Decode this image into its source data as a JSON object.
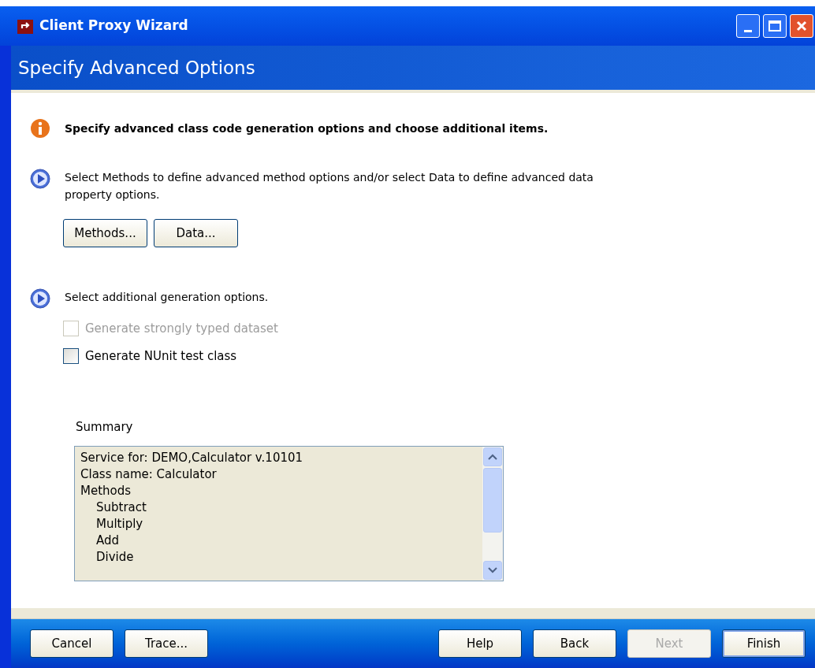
{
  "window": {
    "title": "Client Proxy Wizard"
  },
  "header": {
    "title": "Specify Advanced Options"
  },
  "intro": "Specify advanced class code generation options and choose additional items.",
  "steps": [
    {
      "text": "Select Methods to define advanced method options and/or select Data to define advanced data property options.",
      "buttons": [
        {
          "label": "Methods..."
        },
        {
          "label": "Data..."
        }
      ]
    },
    {
      "text": "Select additional generation options.",
      "options": [
        {
          "label": "Generate strongly typed dataset",
          "checked": false,
          "disabled": true
        },
        {
          "label": "Generate NUnit test class",
          "checked": false,
          "disabled": false
        }
      ]
    }
  ],
  "summary": {
    "label": "Summary",
    "lines": [
      {
        "text": "Service for: DEMO,Calculator v.10101"
      },
      {
        "text": "Class name: Calculator"
      },
      {
        "text": "Methods",
        "children": [
          {
            "text": "Subtract"
          },
          {
            "text": "Multiply"
          },
          {
            "text": "Add"
          },
          {
            "text": "Divide"
          }
        ]
      }
    ]
  },
  "footer": {
    "left": [
      {
        "label": "Cancel",
        "disabled": false,
        "default": false
      },
      {
        "label": "Trace...",
        "disabled": false,
        "default": false
      }
    ],
    "right": [
      {
        "label": "Help",
        "disabled": false,
        "default": false
      },
      {
        "label": "Back",
        "disabled": false,
        "default": false
      },
      {
        "label": "Next",
        "disabled": true,
        "default": false
      },
      {
        "label": "Finish",
        "disabled": false,
        "default": true
      }
    ]
  }
}
